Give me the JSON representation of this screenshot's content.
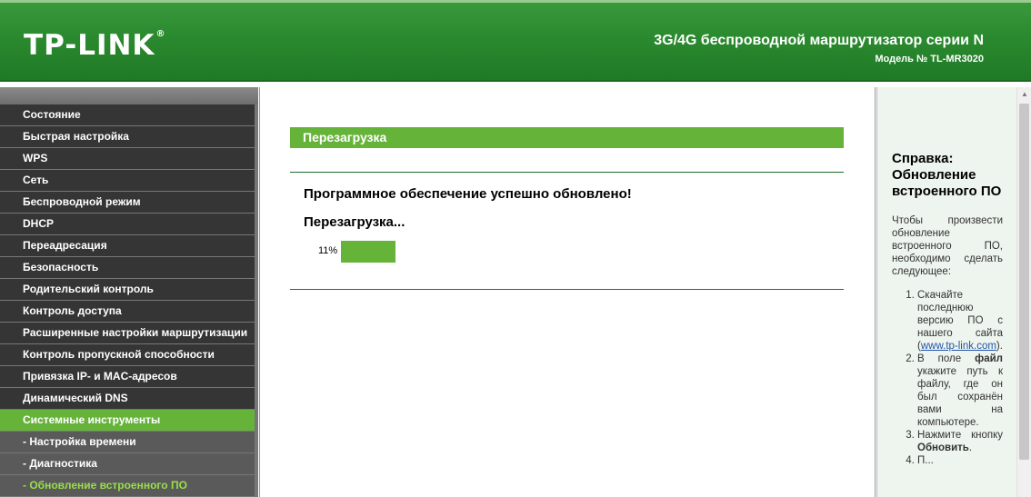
{
  "header": {
    "logo": "TP-LINK",
    "logo_mark": "®",
    "title": "3G/4G беспроводной маршрутизатор серии N",
    "model": "Модель № TL-MR3020"
  },
  "sidebar": {
    "items": [
      {
        "label": "Состояние"
      },
      {
        "label": "Быстрая настройка"
      },
      {
        "label": "WPS"
      },
      {
        "label": "Сеть"
      },
      {
        "label": "Беспроводной режим"
      },
      {
        "label": "DHCP"
      },
      {
        "label": "Переадресация"
      },
      {
        "label": "Безопасность"
      },
      {
        "label": "Родительский контроль"
      },
      {
        "label": "Контроль доступа"
      },
      {
        "label": "Расширенные настройки маршрутизации"
      },
      {
        "label": "Контроль пропускной способности"
      },
      {
        "label": "Привязка IP- и MAC-адресов"
      },
      {
        "label": "Динамический DNS"
      },
      {
        "label": "Системные инструменты"
      },
      {
        "label": "- Настройка времени"
      },
      {
        "label": "- Диагностика"
      },
      {
        "label": "- Обновление встроенного ПО"
      }
    ],
    "active_index": 14,
    "current_sub_index": 17
  },
  "main": {
    "section_title": "Перезагрузка",
    "success_message": "Программное обеспечение успешно обновлено!",
    "rebooting_message": "Перезагрузка...",
    "progress_label": "11%",
    "progress_value": 0.11
  },
  "help": {
    "title": "Справка: Обновление встроенного ПО",
    "intro": "Чтобы произвести обновление встроенного ПО, необходимо сделать следующее:",
    "step1_text": "Скачайте последнюю версию ПО с нашего сайта (",
    "step1_link": "www.tp-link.com",
    "step1_end": ").",
    "step2_pre": "В поле ",
    "step2_bold": "файл",
    "step2_post": " укажите путь к файлу, где он был сохранён вами на компьютере.",
    "step3_pre": "Нажмите кнопку ",
    "step3_bold": "Обновить",
    "step3_post": ".",
    "step4_text": "П..."
  },
  "colors": {
    "header_green": "#2b8a2f",
    "accent_green": "#66b33a",
    "menu_dark": "#353535",
    "current_sub_text": "#9ade4a"
  }
}
